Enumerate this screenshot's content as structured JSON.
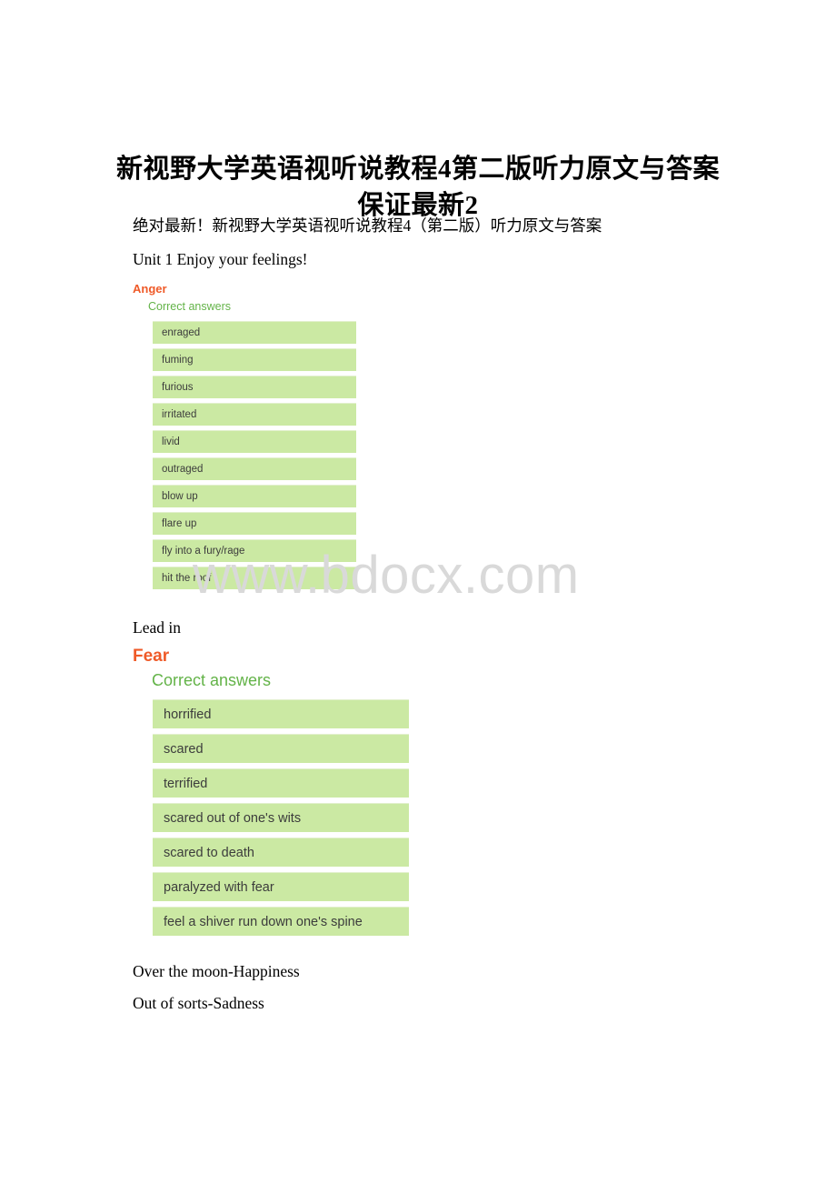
{
  "document": {
    "title": "新视野大学英语视听说教程4第二版听力原文与答案保证最新2",
    "subtitle": "绝对最新！新视野大学英语视听说教程4（第二版）听力原文与答案",
    "unit_heading": "Unit 1 Enjoy your feelings!",
    "lead_in": "Lead in",
    "closing_lines": [
      "Over the moon-Happiness",
      "Out of sorts-Sadness"
    ]
  },
  "watermark": {
    "text": "www.bdocx.com",
    "color": "#d9d9d9"
  },
  "colors": {
    "emotion_heading": "#ef5a28",
    "correct_answers_label": "#63b348",
    "answer_box_background": "#cbe9a3",
    "answer_box_text": "#3c3c3c",
    "page_background": "#ffffff"
  },
  "answer_blocks": [
    {
      "emotion": "Anger",
      "correct_answers_label": "Correct answers",
      "answers": [
        "enraged",
        "fuming",
        "furious",
        "irritated",
        "livid",
        "outraged",
        "blow up",
        "flare up",
        "fly into a fury/rage",
        "hit the roof"
      ]
    },
    {
      "emotion": "Fear",
      "correct_answers_label": "Correct answers",
      "answers": [
        "horrified",
        "scared",
        "terrified",
        "scared out of one's wits",
        "scared to death",
        "paralyzed with fear",
        "feel a shiver run down one's spine"
      ]
    }
  ]
}
